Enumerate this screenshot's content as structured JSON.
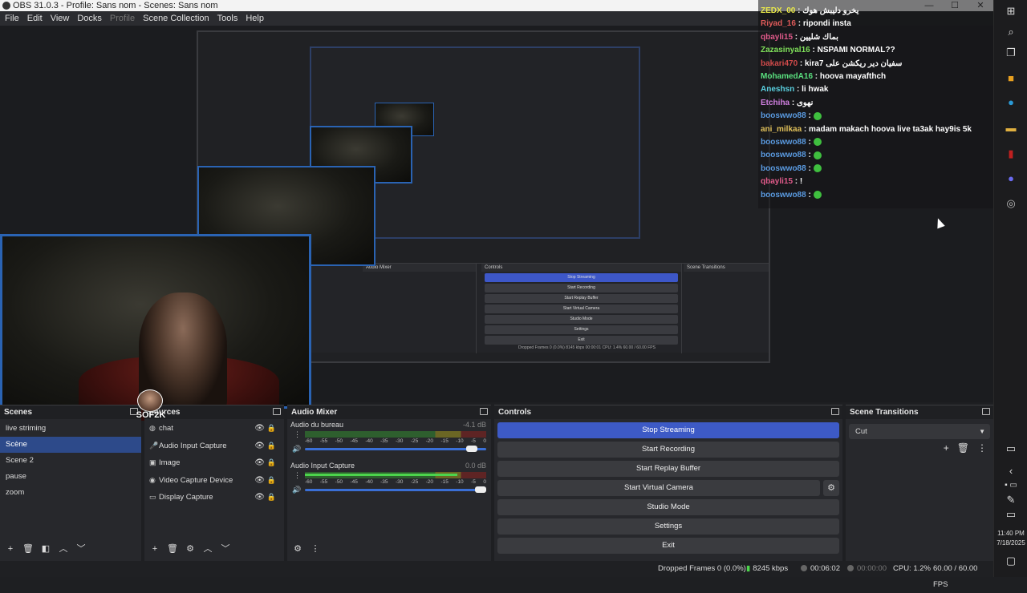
{
  "window": {
    "title": "OBS 31.0.3 - Profile: Sans nom - Scenes: Sans nom",
    "controls": [
      "—",
      "☐",
      "✕"
    ]
  },
  "menu": [
    "File",
    "Edit",
    "View",
    "Docks",
    "Profile",
    "Scene Collection",
    "Tools",
    "Help"
  ],
  "chat": {
    "messages": [
      {
        "user": "ZEDX_00",
        "color": "#e8e84a",
        "text": "يخرو دليبش هوك"
      },
      {
        "user": "Riyad_16",
        "color": "#e05a5a",
        "text": "ripondi insta"
      },
      {
        "user": "qbayli15",
        "color": "#e05a8a",
        "text": "بماك شليين"
      },
      {
        "user": "Zazasinyal16",
        "color": "#7fe05a",
        "text": "NSPAMI NORMAL??"
      },
      {
        "user": "bakari470",
        "color": "#d04a4a",
        "text": "kira7 سفيان دير ريكشن على"
      },
      {
        "user": "MohamedA16",
        "color": "#5ae07f",
        "text": "hoova mayafthch"
      },
      {
        "user": "Aneshsn",
        "color": "#5ad0e0",
        "text": "li hwak"
      },
      {
        "user": "Etchiha",
        "color": "#d07fe0",
        "text": "نهوى"
      },
      {
        "user": "booswwo88",
        "color": "#5a9ae0",
        "text": ""
      },
      {
        "user": "ani_milkaa",
        "color": "#e0c05a",
        "text": "madam makach hoova live ta3ak hay9is 5k"
      },
      {
        "user": "booswwo88",
        "color": "#5a9ae0",
        "text": ""
      },
      {
        "user": "booswwo88",
        "color": "#5a9ae0",
        "text": ""
      },
      {
        "user": "booswwo88",
        "color": "#5a9ae0",
        "text": ""
      },
      {
        "user": "qbayli15",
        "color": "#e05a8a",
        "text": "!"
      },
      {
        "user": "booswwo88",
        "color": "#5a9ae0",
        "text": ""
      }
    ]
  },
  "overlay_name": "SOF2K",
  "nested": {
    "mixer_title": "Audio Mixer",
    "controls_title": "Controls",
    "transitions_title": "Scene Transitions",
    "buttons": [
      "Stop Streaming",
      "Start Recording",
      "Start Replay Buffer",
      "Start Virtual Camera",
      "Studio Mode",
      "Settings",
      "Exit"
    ],
    "status": "Dropped Frames 0 (0.0%)   8145 kbps   00:00:01   CPU: 1.4%   60.00 / 60.00 FPS"
  },
  "scenes": {
    "title": "Scenes",
    "items": [
      "live striming",
      "Scène",
      "Scene 2",
      "pause",
      "zoom"
    ],
    "selected": 1
  },
  "sources": {
    "title": "Sources",
    "items": [
      {
        "label": "chat",
        "icon": "browser-icon"
      },
      {
        "label": "Audio Input Capture",
        "icon": "microphone-icon"
      },
      {
        "label": "Image",
        "icon": "image-icon"
      },
      {
        "label": "Video Capture Device",
        "icon": "camera-icon"
      },
      {
        "label": "Display Capture",
        "icon": "monitor-icon"
      }
    ]
  },
  "mixer": {
    "title": "Audio Mixer",
    "channels": [
      {
        "name": "Audio du bureau",
        "db": "-4.1 dB",
        "level": 0,
        "volume": 0.95
      },
      {
        "name": "Audio Input Capture",
        "db": "0.0 dB",
        "level": 0.84,
        "volume": 1.0
      }
    ],
    "scale": [
      "-60",
      "-55",
      "-50",
      "-45",
      "-40",
      "-35",
      "-30",
      "-25",
      "-20",
      "-15",
      "-10",
      "-5",
      "0"
    ]
  },
  "controls": {
    "title": "Controls",
    "stop_streaming": "Stop Streaming",
    "start_recording": "Start Recording",
    "start_replay": "Start Replay Buffer",
    "start_virtual_camera": "Start Virtual Camera",
    "studio_mode": "Studio Mode",
    "settings": "Settings",
    "exit": "Exit"
  },
  "transitions": {
    "title": "Scene Transitions",
    "selected": "Cut"
  },
  "status": {
    "dropped": "Dropped Frames 0 (0.0%)",
    "kbps": "8245 kbps",
    "stream_time": "00:06:02",
    "rec_time": "00:00:00",
    "cpu": "CPU: 1.2%",
    "fps": "60.00 / 60.00 FPS"
  },
  "taskbar": {
    "time": "11:40 PM",
    "date": "7/18/2025"
  }
}
